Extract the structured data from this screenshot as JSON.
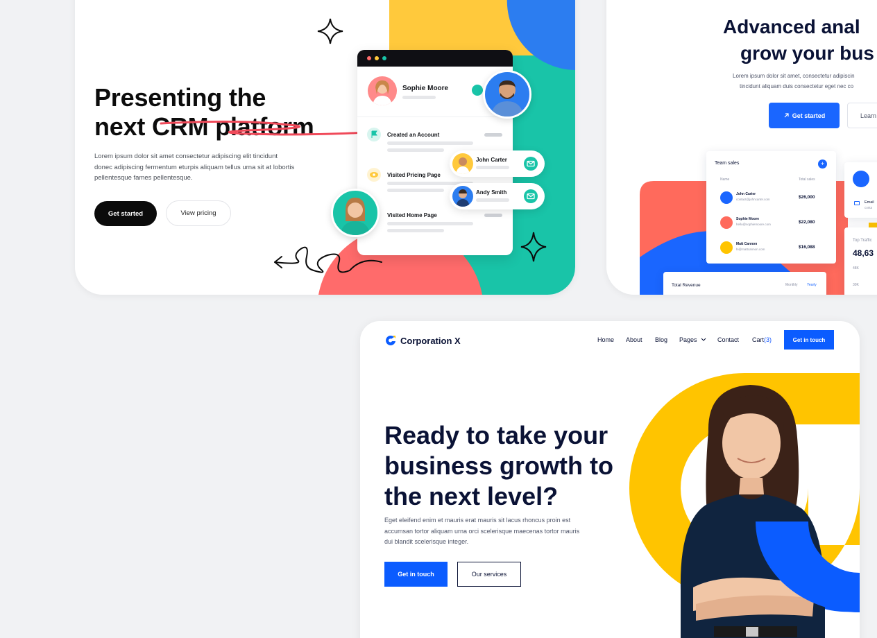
{
  "colors": {
    "crm_black": "#0b0b0b",
    "crm_red": "#ff6b6b",
    "crm_yellow": "#ffc93c",
    "crm_teal": "#19c4a8",
    "crm_blue": "#2c7df0",
    "analytics_blue": "#1a66ff",
    "analytics_navy": "#0a1235",
    "corp_blue": "#0b5cff",
    "corp_yellow": "#ffc400"
  },
  "crm": {
    "title_line1": "Presenting the",
    "title_line2_plain": "next ",
    "title_line2_highlight": "CRM platform",
    "description": "Lorem ipsum dolor sit amet consectetur adipiscing elit tincidunt donec adipiscing fermentum eturpis aliquam tellus urna sit at lobortis pellentesque fames pellentesque.",
    "primary_button": "Get started",
    "secondary_button": "View pricing",
    "mockup": {
      "profile_name": "Sophie Moore",
      "activities": [
        {
          "label": "Created an Account",
          "icon": "flag-icon"
        },
        {
          "label": "Visited Pricing Page",
          "icon": "eye-icon"
        },
        {
          "label": "Visited Home Page",
          "icon": "none"
        }
      ],
      "contacts": [
        "John Carter",
        "Andy Smith"
      ]
    }
  },
  "analytics": {
    "title_line1": "Advanced anal",
    "title_line2": "grow your bus",
    "description_line1": "Lorem ipsum dolor sit amet, consectetur adipiscin",
    "description_line2": "tincidunt aliquam duis consectetur eget nec co",
    "primary_button": "Get started",
    "secondary_button": "Learn",
    "team_sales": {
      "title": "Team sales",
      "columns": [
        "Name",
        "Total sales"
      ],
      "rows": [
        {
          "name": "John Carter",
          "email": "contact@johncarter.com",
          "total": "$26,000"
        },
        {
          "name": "Sophie Moore",
          "email": "hello@sophiemoore.com",
          "total": "$22,080"
        },
        {
          "name": "Matt Cannon",
          "email": "hi@mattcannon.com",
          "total": "$16,088"
        }
      ]
    },
    "revenue": {
      "title": "Total Revenue",
      "tabs": [
        "Monthly",
        "Yearly"
      ]
    },
    "side_panel": {
      "email_label": "Email",
      "email_value": "conta",
      "traffic_label": "Top Traffic",
      "traffic_value": "48,63",
      "axis": [
        "48K",
        "30K"
      ]
    }
  },
  "corp": {
    "logo_text": "Corporation X",
    "nav": {
      "home": "Home",
      "about": "About",
      "blog": "Blog",
      "pages": "Pages",
      "contact": "Contact",
      "cart_label": "Cart",
      "cart_count": "(3)",
      "cta": "Get in touch"
    },
    "title_line1": "Ready to take your",
    "title_line2": "business growth to",
    "title_line3": "the next level?",
    "desc_line1": "Eget eleifend enim et mauris erat mauris sit lacus rhoncus proin est",
    "desc_line2": "accumsan tortor aliquam urna orci scelerisque maecenas tortor mauris",
    "desc_line3": "dui blandit scelerisque integer.",
    "primary_button": "Get in touch",
    "secondary_button": "Our services"
  }
}
